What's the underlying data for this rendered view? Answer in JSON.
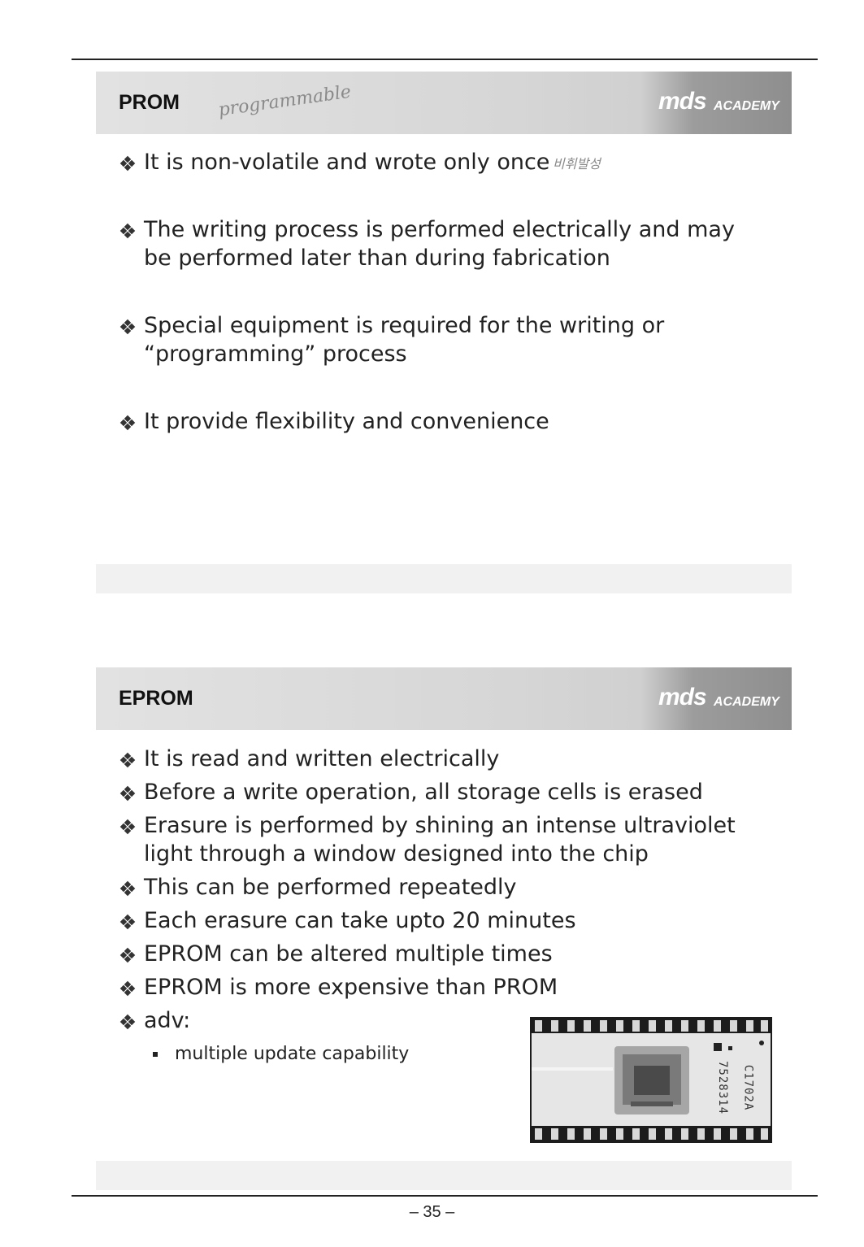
{
  "prom": {
    "title": "PROM",
    "handwritten_note": "programmable",
    "handwritten_side_note": "비휘발성",
    "logo": {
      "brand": "mds",
      "sub": "ACADEMY"
    },
    "bullets": [
      "It is non-volatile and wrote only once",
      "The writing process is performed electrically and may be performed later than during fabrication",
      "Special equipment is required for the writing or “programming” process",
      "It provide flexibility and convenience"
    ]
  },
  "eprom": {
    "title": "EPROM",
    "logo": {
      "brand": "mds",
      "sub": "ACADEMY"
    },
    "bullets": [
      "It is read and written electrically",
      "Before a write operation, all storage cells is erased",
      "Erasure is performed by shining an intense ultraviolet light through a window designed into the chip",
      "This can be performed repeatedly",
      "Each erasure can take upto 20 minutes",
      "EPROM can be altered multiple times",
      "EPROM is more expensive than PROM",
      "adv:"
    ],
    "sub_bullets": [
      "multiple update capability"
    ],
    "chip_labels": [
      "C1702A",
      "7528314"
    ]
  },
  "page_number": "– 35 –"
}
